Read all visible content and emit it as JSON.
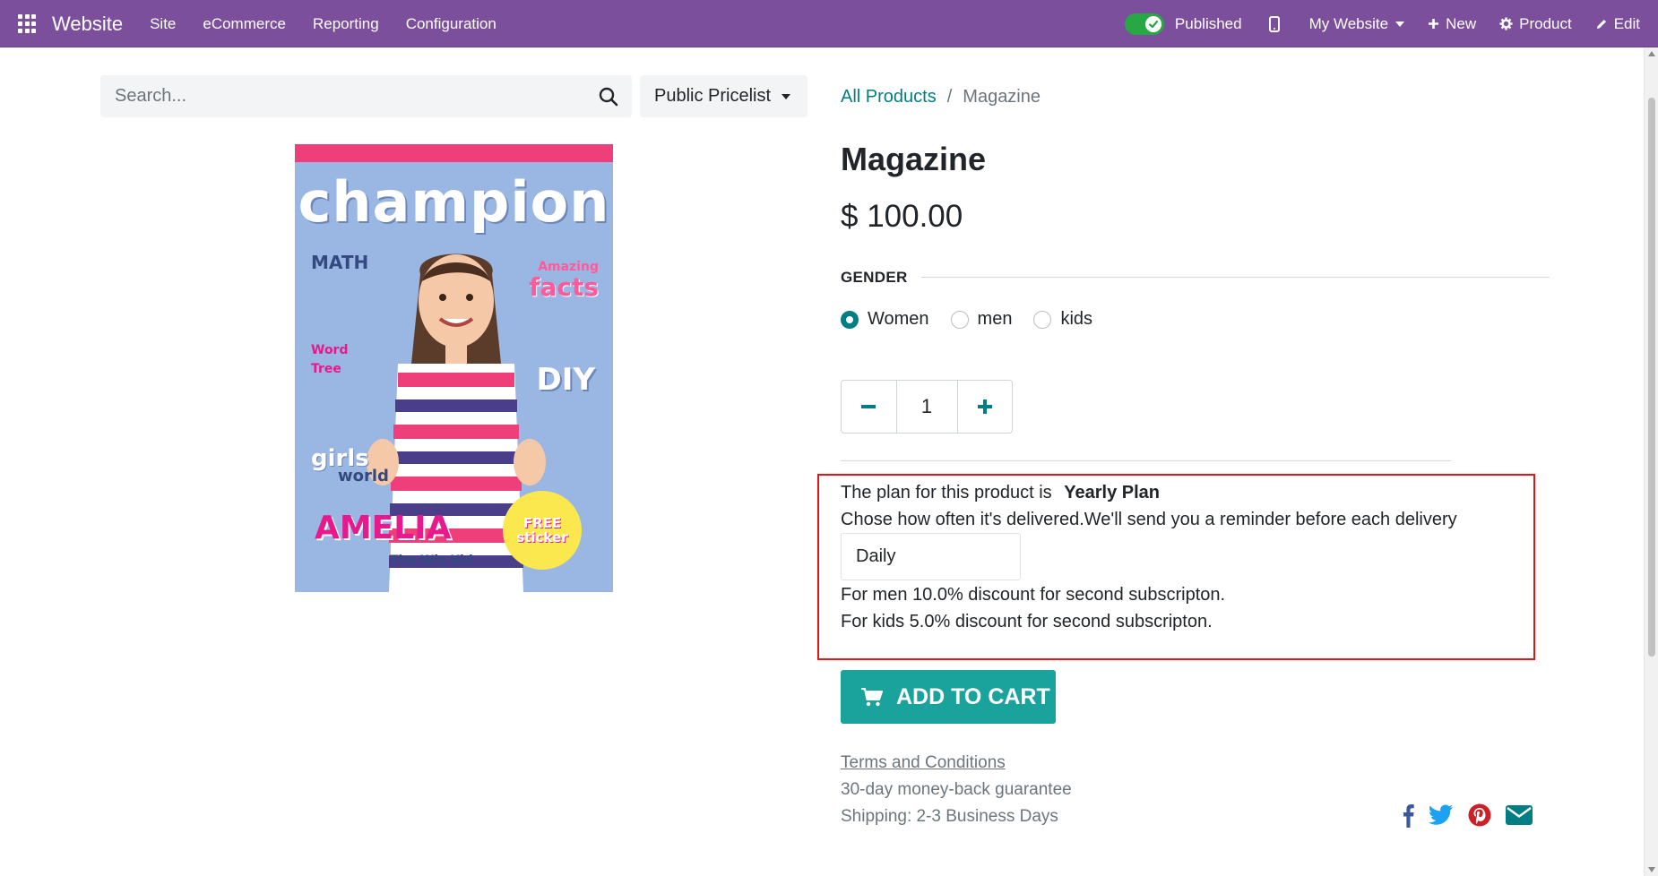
{
  "topbar": {
    "brand": "Website",
    "menu": [
      "Site",
      "eCommerce",
      "Reporting",
      "Configuration"
    ],
    "published_label": "Published",
    "website_label": "My Website",
    "new_label": "New",
    "product_label": "Product",
    "edit_label": "Edit"
  },
  "search": {
    "placeholder": "Search..."
  },
  "pricelist": {
    "label": "Public Pricelist"
  },
  "breadcrumb": {
    "parent": "All Products",
    "separator": "/",
    "current": "Magazine"
  },
  "product_image": {
    "title": "champion",
    "math": "MATH",
    "amazing": "Amazing",
    "facts": "facts",
    "word1": "Word",
    "word2": "Tree",
    "diy": "DIY",
    "girls": "girls",
    "world": "world",
    "amelia": "AMELIA",
    "whiz": "The Wiz Kid",
    "free": "FREE",
    "sticker": "sticker"
  },
  "product": {
    "title": "Magazine",
    "price": "$ 100.00",
    "attribute_label": "GENDER",
    "options": [
      "Women",
      "men",
      "kids"
    ],
    "selected_option": "Women",
    "quantity": "1"
  },
  "plan": {
    "intro": "The plan for this product is",
    "plan_name": "Yearly Plan",
    "description": "Chose how often it's delivered.We'll send you a reminder before each delivery",
    "frequency": "Daily",
    "discount_1": "For  men 10.0% discount for second subscripton.",
    "discount_2": "For  kids 5.0% discount for second subscripton."
  },
  "cart": {
    "label": "ADD TO CART"
  },
  "footer": {
    "terms": "Terms and Conditions",
    "guarantee": "30-day money-back guarantee",
    "shipping": "Shipping: 2-3 Business Days"
  },
  "colors": {
    "topbar": "#7c4f9c",
    "accent": "#017e84",
    "cart_button": "#1aa39c",
    "highlight_border": "#e3141a",
    "facebook": "#3b5998",
    "twitter": "#1da1f2",
    "pinterest": "#cb2027",
    "email": "#017e84"
  },
  "icons": [
    "apps-icon",
    "check-icon",
    "mobile-icon",
    "plus-icon",
    "gear-icon",
    "pencil-icon",
    "search-icon",
    "minus-icon",
    "cart-icon",
    "facebook-icon",
    "twitter-icon",
    "pinterest-icon",
    "envelope-icon"
  ]
}
